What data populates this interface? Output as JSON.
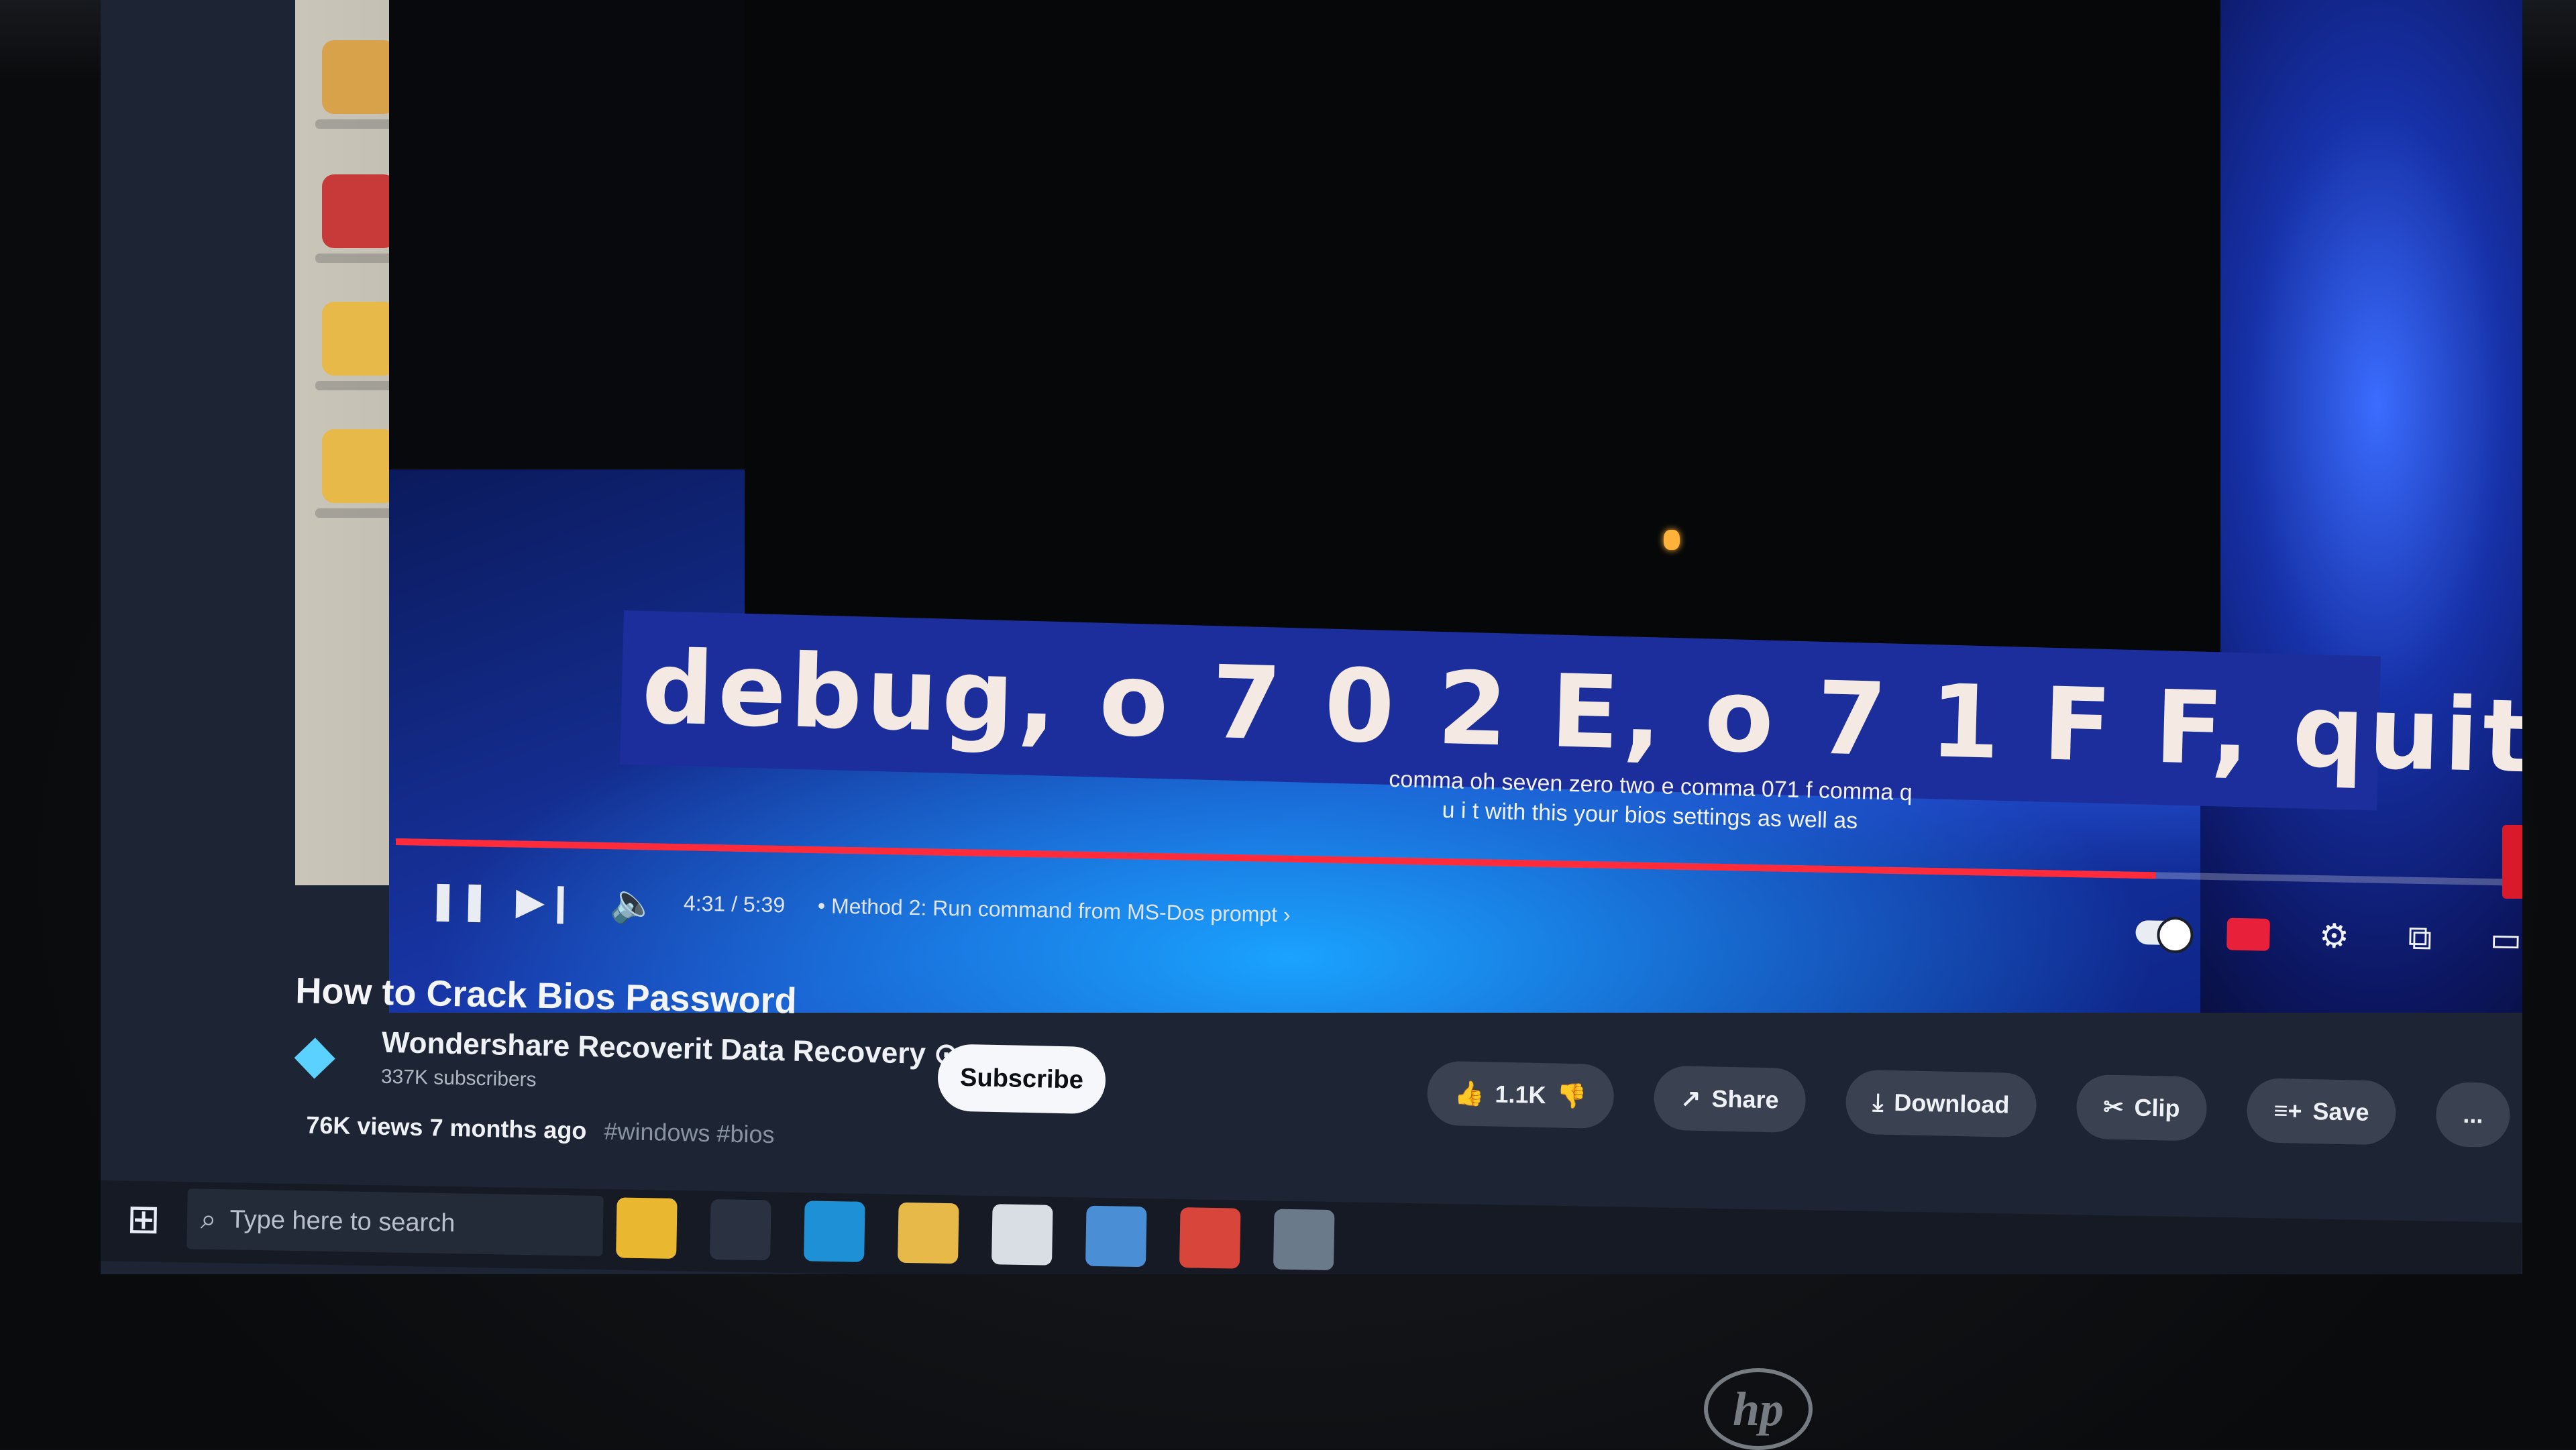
{
  "captions": {
    "big": "debug, o 7 0 2 E, o 7 1 F F, quit",
    "small_line1": "comma oh seven zero two e comma 071 f comma q",
    "small_line2": "u i t with this your bios settings as well as"
  },
  "player": {
    "time": "4:31 / 5:39",
    "chapter": "• Method 2: Run command from MS-Dos prompt ›",
    "progress_fraction": 0.8,
    "icons": {
      "play_pause": "pause-icon",
      "next": "next-icon",
      "volume": "volume-icon",
      "autoplay": "autoplay-toggle-icon",
      "captions": "captions-icon",
      "settings": "gear-icon",
      "miniplayer": "miniplayer-icon",
      "theater": "theater-icon",
      "fullscreen": "fullscreen-icon"
    }
  },
  "video": {
    "title": "How to Crack Bios Password",
    "channel": "Wondershare Recoverit Data Recovery ⊙",
    "subscribers": "337K subscribers",
    "subscribe_label": "Subscribe",
    "views": "76K views",
    "age": "7 months ago",
    "tags": "#windows #bios"
  },
  "actions": {
    "like": "1.1K",
    "share": "Share",
    "download": "Download",
    "clip": "Clip",
    "save": "Save",
    "more": "..."
  },
  "taskbar": {
    "search_placeholder": "Type here to search"
  },
  "colors": {
    "progress": "#ff2a3a",
    "caption_bg": "#1c2e9c",
    "wallpaper_blue": "#2f6cff"
  }
}
